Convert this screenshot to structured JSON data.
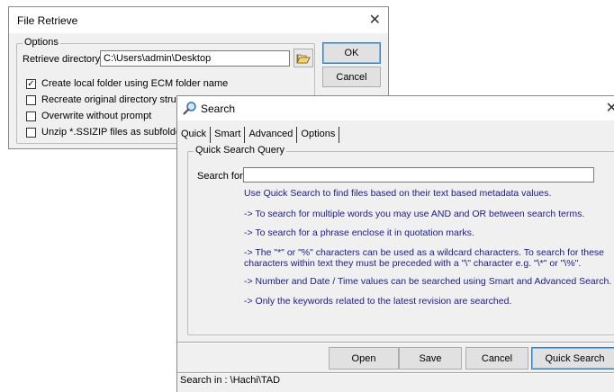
{
  "file_retrieve": {
    "title": "File Retrieve",
    "close_glyph": "✕",
    "options_group_label": "Options",
    "retrieve_dir_label": "Retrieve directory:",
    "retrieve_dir_value": "C:\\Users\\admin\\Desktop",
    "browse_icon": "folder-open-icon",
    "ok_label": "OK",
    "cancel_label": "Cancel",
    "checkboxes": [
      {
        "label": "Create local folder using ECM folder name",
        "checked": true,
        "mark": "✓"
      },
      {
        "label": "Recreate original directory structure",
        "checked": false,
        "mark": ""
      },
      {
        "label": "Overwrite without prompt",
        "checked": false,
        "mark": ""
      },
      {
        "label": "Unzip *.SSIZIP files as subfolders",
        "checked": false,
        "mark": ""
      }
    ]
  },
  "search": {
    "title": "Search",
    "title_icon": "search-icon",
    "close_glyph": "✕",
    "tabs": [
      "Quick",
      "Smart",
      "Advanced",
      "Options"
    ],
    "active_tab": "Quick",
    "group_label": "Quick Search Query",
    "search_for_label": "Search for:",
    "search_for_value": "",
    "help_lines": [
      "Use Quick Search to find files based on their text based metadata values.",
      "-> To search for multiple words you may use AND and OR between search terms.",
      "-> To search for a phrase enclose it in quotation marks.",
      "-> The \"*\" or \"%\" characters can be used as a wildcard characters.  To search for these",
      "characters within text they must be preceded with a \"\\\" character e.g. \"\\*\" or \"\\%\".",
      "-> Number and Date / Time values can be searched using Smart and Advanced Search.",
      "-> Only the keywords related to the latest revision are searched."
    ],
    "buttons": {
      "open": "Open",
      "save": "Save",
      "cancel": "Cancel",
      "quick_search": "Quick Search"
    },
    "status": "Search in : \\Hachi\\TAD",
    "help_text_color": "#1a1a8c"
  }
}
